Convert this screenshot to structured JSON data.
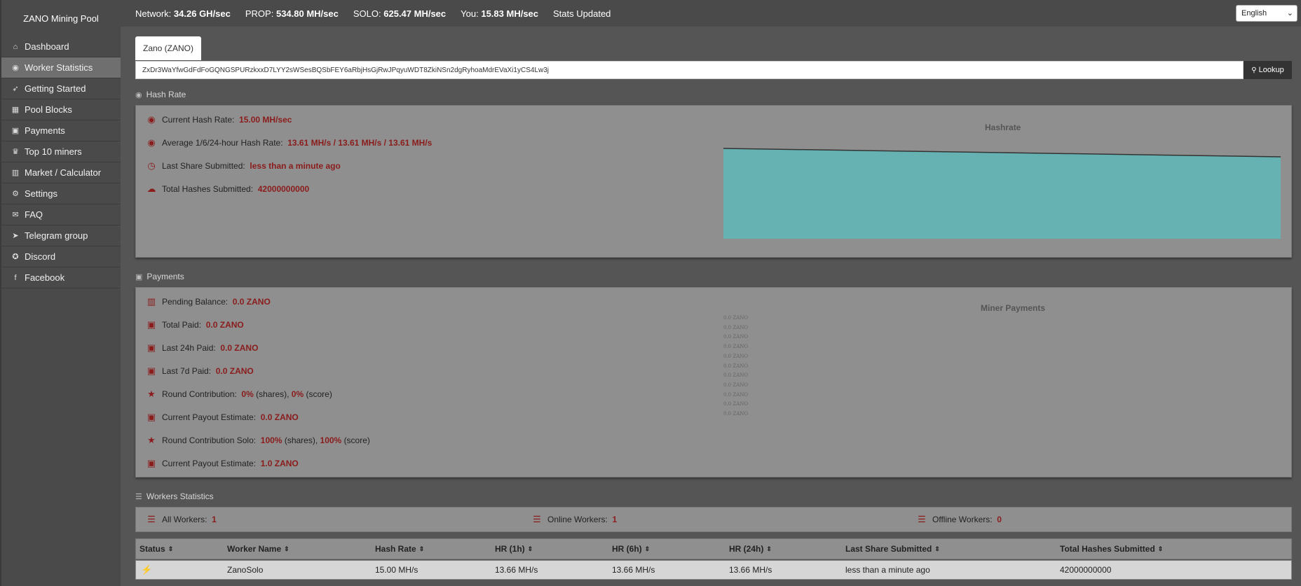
{
  "brand": "ZANO Mining Pool",
  "sidebar": {
    "items": [
      {
        "label": "Dashboard",
        "icon": "home-icon",
        "glyph": "⌂"
      },
      {
        "label": "Worker Statistics",
        "icon": "tachometer-icon",
        "glyph": "◉",
        "active": true
      },
      {
        "label": "Getting Started",
        "icon": "rocket-icon",
        "glyph": "➶"
      },
      {
        "label": "Pool Blocks",
        "icon": "cubes-icon",
        "glyph": "▦"
      },
      {
        "label": "Payments",
        "icon": "money-icon",
        "glyph": "▣"
      },
      {
        "label": "Top 10 miners",
        "icon": "trophy-icon",
        "glyph": "♛"
      },
      {
        "label": "Market / Calculator",
        "icon": "bank-icon",
        "glyph": "▥"
      },
      {
        "label": "Settings",
        "icon": "cogs-icon",
        "glyph": "⚙"
      },
      {
        "label": "FAQ",
        "icon": "comments-icon",
        "glyph": "✉"
      },
      {
        "label": "Telegram group",
        "icon": "telegram-icon",
        "glyph": "➤"
      },
      {
        "label": "Discord",
        "icon": "discord-icon",
        "glyph": "✪"
      },
      {
        "label": "Facebook",
        "icon": "facebook-icon",
        "glyph": "f"
      }
    ]
  },
  "topbar": {
    "network_label": "Network:",
    "network_value": "34.26 GH/sec",
    "prop_label": "PROP:",
    "prop_value": "534.80 MH/sec",
    "solo_label": "SOLO:",
    "solo_value": "625.47 MH/sec",
    "you_label": "You:",
    "you_value": "15.83 MH/sec",
    "stats_updated": "Stats Updated",
    "language": "English"
  },
  "coin_tab": "Zano (ZANO)",
  "lookup": {
    "address": "ZxDr3WaYfwGdFdFoGQNGSPURzkxxD7LYY2sWSesBQSbFEY6aRbjHsGjRwJPqyuWDT8ZkiNSn2dgRyhoaMdrEVaXi1yCS4Lw3j",
    "button": "Lookup"
  },
  "hashrate": {
    "section_title": "Hash Rate",
    "current_label": "Current Hash Rate",
    "current_value": "15.00 MH/sec",
    "average_label": "Average 1/6/24-hour Hash Rate",
    "average_value": "13.61 MH/s / 13.61 MH/s / 13.61 MH/s",
    "last_share_label": "Last Share Submitted",
    "last_share_value": "less than a minute ago",
    "total_hashes_label": "Total Hashes Submitted",
    "total_hashes_value": "42000000000",
    "chart_title": "Hashrate"
  },
  "payments": {
    "section_title": "Payments",
    "pending_label": "Pending Balance",
    "pending_value": "0.0 ZANO",
    "total_paid_label": "Total Paid",
    "total_paid_value": "0.0 ZANO",
    "last24_label": "Last 24h Paid",
    "last24_value": "0.0 ZANO",
    "last7_label": "Last 7d Paid",
    "last7_value": "0.0 ZANO",
    "round_label": "Round Contribution",
    "round_shares": "0%",
    "round_shares_unit": "(shares),",
    "round_score": "0%",
    "round_score_unit": "(score)",
    "payout_label": "Current Payout Estimate",
    "payout_value": "0.0 ZANO",
    "round_solo_label": "Round Contribution Solo",
    "round_solo_shares": "100%",
    "round_solo_shares_unit": "(shares),",
    "round_solo_score": "100%",
    "round_solo_score_unit": "(score)",
    "payout_solo_label": "Current Payout Estimate",
    "payout_solo_value": "1.0 ZANO",
    "chart_title": "Miner Payments",
    "chart_labels": [
      "0.0 ZANO",
      "0.0 ZANO",
      "0.0 ZANO",
      "0.0 ZANO",
      "0.0 ZANO",
      "0.0 ZANO",
      "0.0 ZANO",
      "0.0 ZANO",
      "0.0 ZANO",
      "0.0 ZANO",
      "0.0 ZANO"
    ]
  },
  "workers": {
    "section_title": "Workers Statistics",
    "all_label": "All Workers",
    "all_value": "1",
    "online_label": "Online Workers",
    "online_value": "1",
    "offline_label": "Offline Workers",
    "offline_value": "0",
    "columns": [
      "Status",
      "Worker Name",
      "Hash Rate",
      "HR (1h)",
      "HR (6h)",
      "HR (24h)",
      "Last Share Submitted",
      "Total Hashes Submitted"
    ],
    "rows": [
      {
        "status_icon": "plug-icon",
        "name": "ZanoSolo",
        "hashrate": "15.00 MH/s",
        "hr1": "13.66 MH/s",
        "hr6": "13.66 MH/s",
        "hr24": "13.66 MH/s",
        "last_share": "less than a minute ago",
        "total": "42000000000"
      }
    ]
  },
  "colors": {
    "accent_red": "#8b1c1c",
    "chart_fill": "#66b2b2",
    "chart_line": "#333333",
    "online_green": "#2e9e2e"
  },
  "chart_data": {
    "type": "area",
    "title": "Hashrate",
    "series": [
      {
        "values": [
          15.0,
          14.3,
          13.61
        ]
      }
    ]
  }
}
